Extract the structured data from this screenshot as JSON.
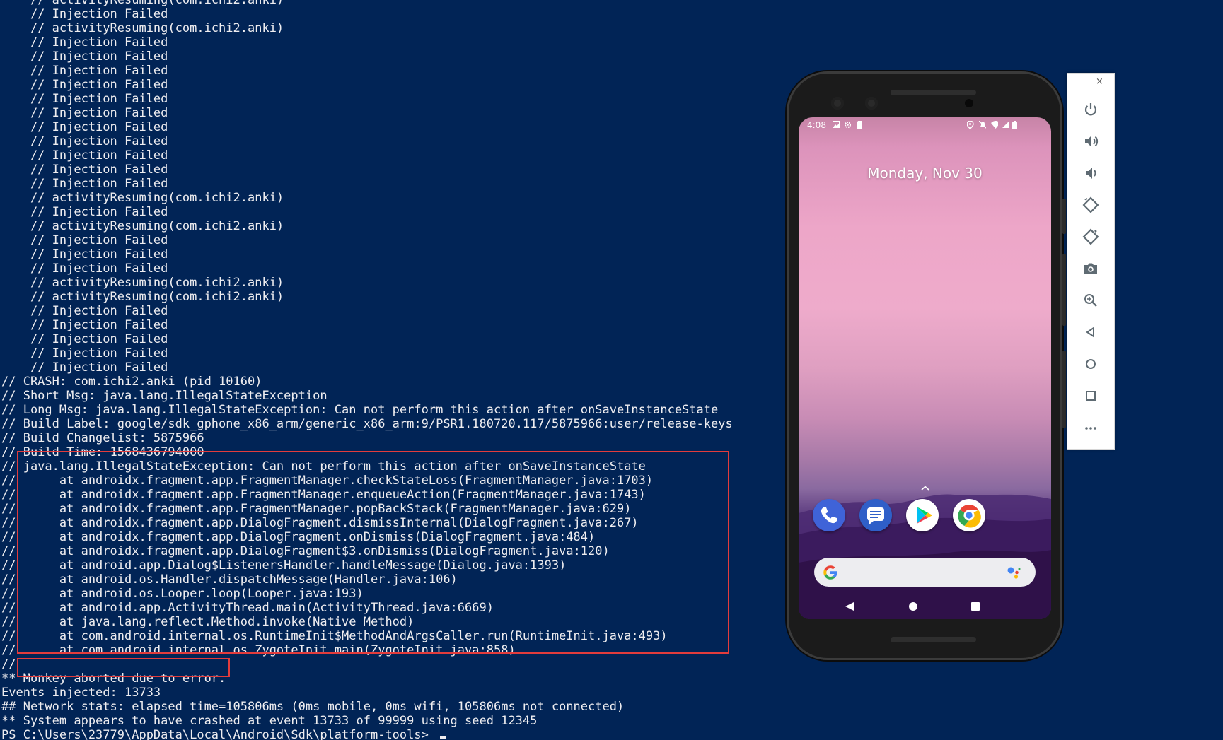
{
  "console": {
    "lines": [
      "    // activityResuming(com.ichi2.anki)",
      "    // Injection Failed",
      "    // activityResuming(com.ichi2.anki)",
      "    // Injection Failed",
      "    // Injection Failed",
      "    // Injection Failed",
      "    // Injection Failed",
      "    // Injection Failed",
      "    // Injection Failed",
      "    // Injection Failed",
      "    // Injection Failed",
      "    // Injection Failed",
      "    // Injection Failed",
      "    // Injection Failed",
      "    // activityResuming(com.ichi2.anki)",
      "    // Injection Failed",
      "    // activityResuming(com.ichi2.anki)",
      "    // Injection Failed",
      "    // Injection Failed",
      "    // Injection Failed",
      "    // activityResuming(com.ichi2.anki)",
      "    // activityResuming(com.ichi2.anki)",
      "    // Injection Failed",
      "    // Injection Failed",
      "    // Injection Failed",
      "    // Injection Failed",
      "    // Injection Failed",
      "// CRASH: com.ichi2.anki (pid 10160)",
      "// Short Msg: java.lang.IllegalStateException",
      "// Long Msg: java.lang.IllegalStateException: Can not perform this action after onSaveInstanceState",
      "// Build Label: google/sdk_gphone_x86_arm/generic_x86_arm:9/PSR1.180720.117/5875966:user/release-keys",
      "// Build Changelist: 5875966",
      "// Build Time: 1568436794000",
      "// java.lang.IllegalStateException: Can not perform this action after onSaveInstanceState",
      "//      at androidx.fragment.app.FragmentManager.checkStateLoss(FragmentManager.java:1703)",
      "//      at androidx.fragment.app.FragmentManager.enqueueAction(FragmentManager.java:1743)",
      "//      at androidx.fragment.app.FragmentManager.popBackStack(FragmentManager.java:629)",
      "//      at androidx.fragment.app.DialogFragment.dismissInternal(DialogFragment.java:267)",
      "//      at androidx.fragment.app.DialogFragment.onDismiss(DialogFragment.java:484)",
      "//      at androidx.fragment.app.DialogFragment$3.onDismiss(DialogFragment.java:120)",
      "//      at android.app.Dialog$ListenersHandler.handleMessage(Dialog.java:1393)",
      "//      at android.os.Handler.dispatchMessage(Handler.java:106)",
      "//      at android.os.Looper.loop(Looper.java:193)",
      "//      at android.app.ActivityThread.main(ActivityThread.java:6669)",
      "//      at java.lang.reflect.Method.invoke(Native Method)",
      "//      at com.android.internal.os.RuntimeInit$MethodAndArgsCaller.run(RuntimeInit.java:493)",
      "//      at com.android.internal.os.ZygoteInit.main(ZygoteInit.java:858)",
      "//",
      "** Monkey aborted due to error.",
      "Events injected: 13733",
      "## Network stats: elapsed time=105806ms (0ms mobile, 0ms wifi, 105806ms not connected)",
      "** System appears to have crashed at event 13733 of 99999 using seed 12345"
    ],
    "prompt": "PS C:\\Users\\23779\\AppData\\Local\\Android\\Sdk\\platform-tools> ",
    "colors": {
      "background": "#012456",
      "text": "#eeedf0",
      "highlight_border": "#e23c3c"
    }
  },
  "phone": {
    "status_time": "4:08",
    "date": "Monday, Nov 30",
    "dock_apps": [
      "phone-app-icon",
      "messages-app-icon",
      "play-store-app-icon",
      "chrome-app-icon"
    ]
  },
  "toolbar": {
    "minimize": "–",
    "close": "×",
    "buttons": [
      "power",
      "volume-up",
      "volume-down",
      "rotate-left",
      "rotate-right",
      "screenshot",
      "zoom",
      "back",
      "home",
      "overview",
      "more"
    ]
  }
}
